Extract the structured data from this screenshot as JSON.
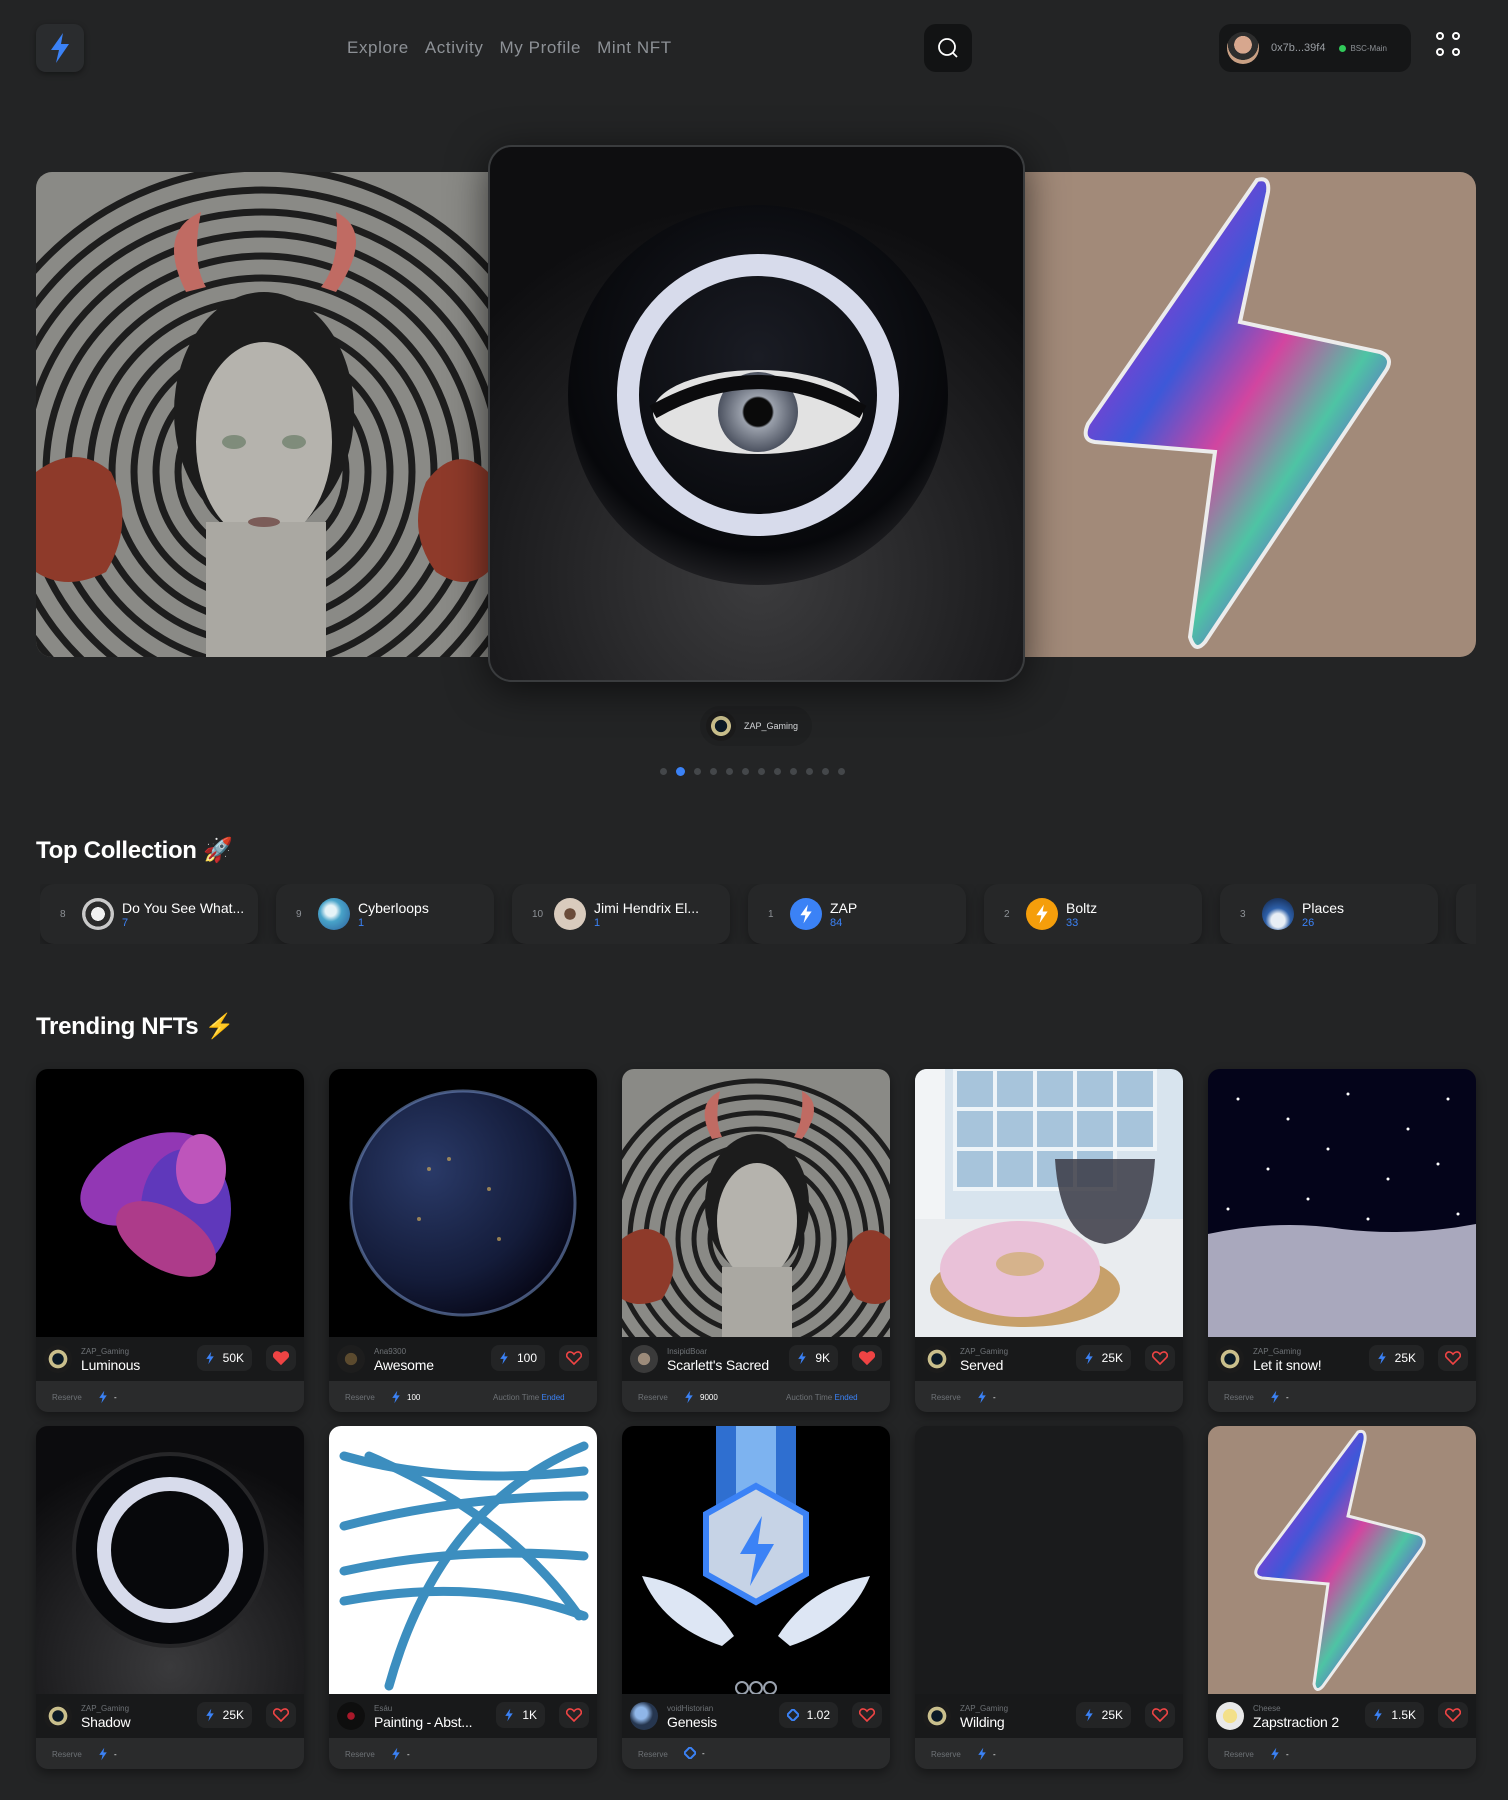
{
  "nav": {
    "links": [
      "Explore",
      "Activity",
      "My Profile",
      "Mint NFT"
    ],
    "wallet_address": "0x7b...39f4",
    "network": "BSC-Main"
  },
  "carousel": {
    "creator": "ZAP_Gaming",
    "dot_count": 12,
    "active_dot": 1
  },
  "top_collection": {
    "title": "Top Collection 🚀",
    "items": [
      {
        "rank": "8",
        "name": "Do You See What...",
        "count": "7"
      },
      {
        "rank": "9",
        "name": "Cyberloops",
        "count": "1"
      },
      {
        "rank": "10",
        "name": "Jimi Hendrix El...",
        "count": "1"
      },
      {
        "rank": "1",
        "name": "ZAP",
        "count": "84"
      },
      {
        "rank": "2",
        "name": "Boltz",
        "count": "33"
      },
      {
        "rank": "3",
        "name": "Places",
        "count": "26"
      }
    ]
  },
  "trending": {
    "title": "Trending NFTs ⚡",
    "cards": [
      {
        "owner": "ZAP_Gaming",
        "title": "Luminous",
        "price": "50K",
        "liked": true,
        "reserve_label": "Reserve",
        "reserve": "-",
        "auction_label": "",
        "auction_status": ""
      },
      {
        "owner": "Ana9300",
        "title": "Awesome",
        "price": "100",
        "liked": false,
        "reserve_label": "Reserve",
        "reserve": "100",
        "auction_label": "Auction Time",
        "auction_status": "Ended"
      },
      {
        "owner": "InsipidBoar",
        "title": "Scarlett's Sacred",
        "price": "9K",
        "liked": true,
        "reserve_label": "Reserve",
        "reserve": "9000",
        "auction_label": "Auction Time",
        "auction_status": "Ended"
      },
      {
        "owner": "ZAP_Gaming",
        "title": "Served",
        "price": "25K",
        "liked": false,
        "reserve_label": "Reserve",
        "reserve": "-",
        "auction_label": "",
        "auction_status": ""
      },
      {
        "owner": "ZAP_Gaming",
        "title": "Let it snow!",
        "price": "25K",
        "liked": false,
        "reserve_label": "Reserve",
        "reserve": "-",
        "auction_label": "",
        "auction_status": ""
      },
      {
        "owner": "ZAP_Gaming",
        "title": "Shadow",
        "price": "25K",
        "liked": false,
        "reserve_label": "Reserve",
        "reserve": "-",
        "auction_label": "",
        "auction_status": ""
      },
      {
        "owner": "Esáu",
        "title": "Painting - Abst...",
        "price": "1K",
        "liked": false,
        "reserve_label": "Reserve",
        "reserve": "-",
        "auction_label": "",
        "auction_status": ""
      },
      {
        "owner": "voidHistorian",
        "title": "Genesis",
        "price": "1.02",
        "liked": false,
        "reserve_label": "Reserve",
        "reserve": "-",
        "auction_label": "",
        "auction_status": ""
      },
      {
        "owner": "ZAP_Gaming",
        "title": "Wilding",
        "price": "25K",
        "liked": false,
        "reserve_label": "Reserve",
        "reserve": "-",
        "auction_label": "",
        "auction_status": ""
      },
      {
        "owner": "Cheese",
        "title": "Zapstraction 2",
        "price": "1.5K",
        "liked": false,
        "reserve_label": "Reserve",
        "reserve": "-",
        "auction_label": "",
        "auction_status": ""
      }
    ]
  },
  "colors": {
    "accent": "#3b82f6",
    "like": "#ef4444",
    "bg": "#232425"
  }
}
